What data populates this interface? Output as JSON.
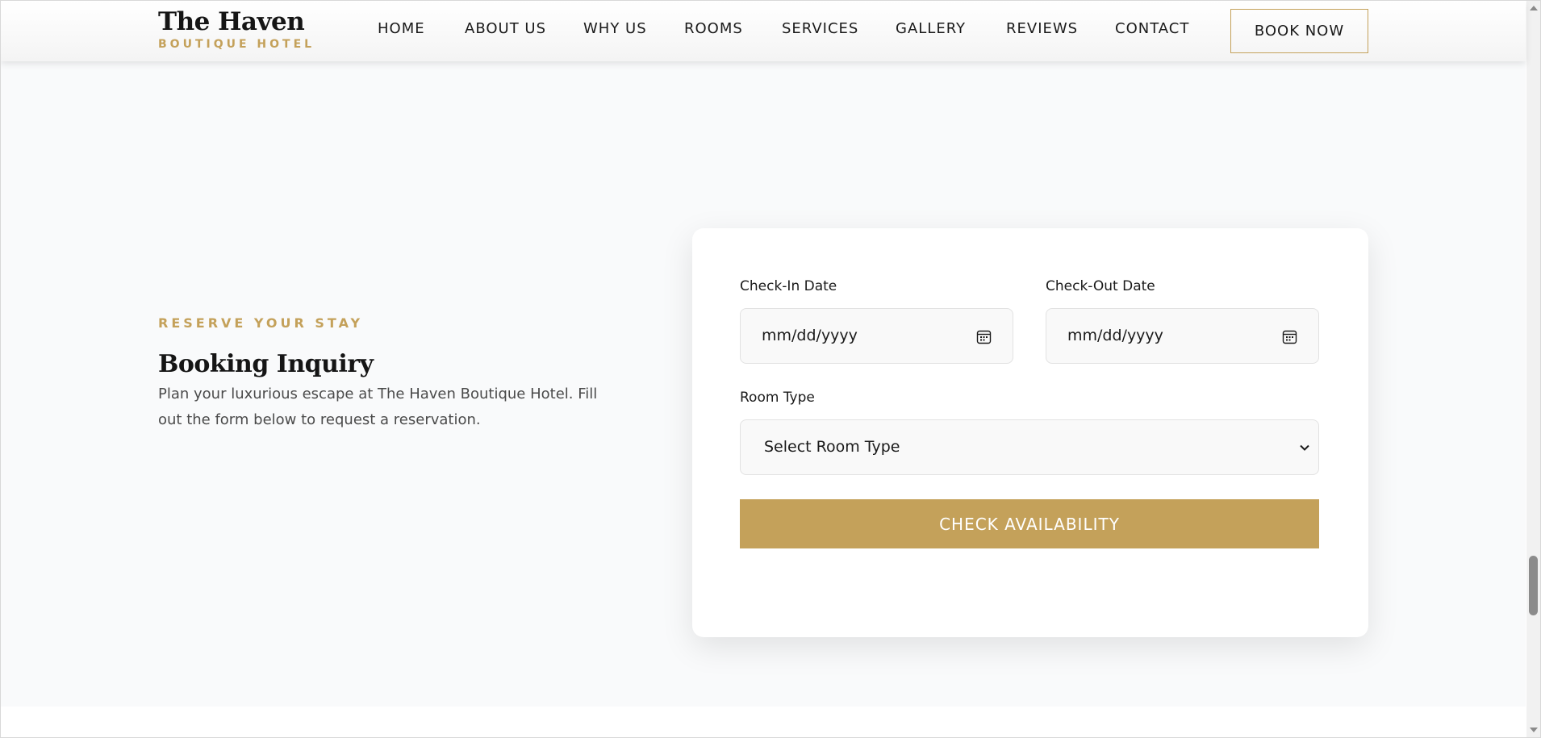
{
  "header": {
    "logo_title": "The Haven",
    "logo_subtitle": "BOUTIQUE HOTEL",
    "nav": [
      "HOME",
      "ABOUT US",
      "WHY US",
      "ROOMS",
      "SERVICES",
      "GALLERY",
      "REVIEWS",
      "CONTACT"
    ],
    "book_now": "BOOK NOW"
  },
  "booking": {
    "eyebrow": "RESERVE YOUR STAY",
    "title": "Booking Inquiry",
    "description": "Plan your luxurious escape at The Haven Boutique Hotel. Fill out the form below to request a reservation."
  },
  "form": {
    "check_in_label": "Check-In Date",
    "check_in_placeholder": "mm/dd/yyyy",
    "check_out_label": "Check-Out Date",
    "check_out_placeholder": "mm/dd/yyyy",
    "room_type_label": "Room Type",
    "room_type_value": "Select Room Type",
    "submit": "CHECK AVAILABILITY"
  },
  "colors": {
    "accent": "#c4a15a",
    "section_bg": "#f9fafb",
    "text": "#1a1a1a"
  },
  "icons": {
    "calendar": "calendar-icon",
    "chevron": "chevron-down-icon"
  }
}
